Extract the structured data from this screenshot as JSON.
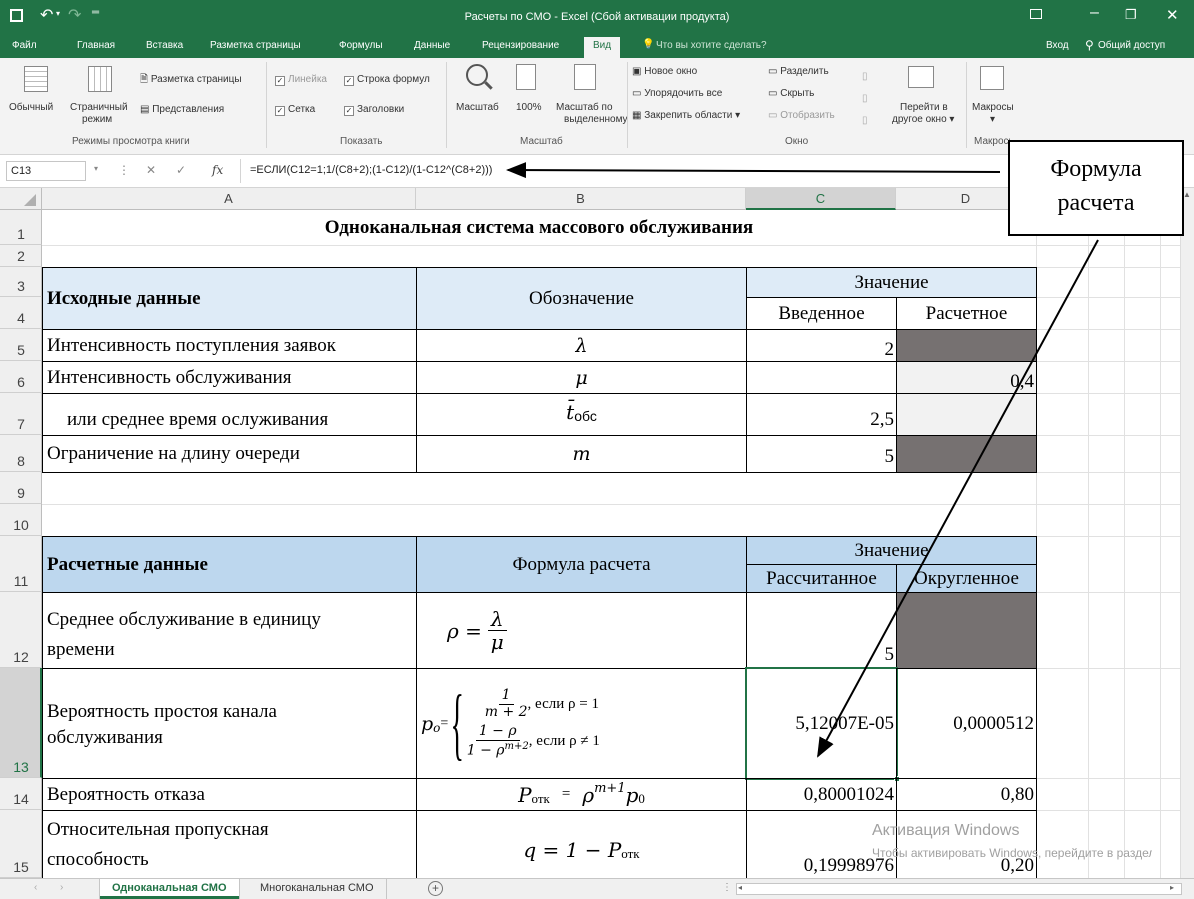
{
  "titlebar": {
    "title": "Расчеты по СМО - Excel (Сбой активации продукта)",
    "undo_icon": "undo-icon",
    "redo_icon": "redo-icon"
  },
  "ribbon_tabs": [
    "Файл",
    "Главная",
    "Вставка",
    "Разметка страницы",
    "Формулы",
    "Данные",
    "Рецензирование",
    "Вид"
  ],
  "tell_me": "Что вы хотите сделать?",
  "account": {
    "signin": "Вход",
    "share": "Общий доступ"
  },
  "ribbon": {
    "views": {
      "normal": "Обычный",
      "page_break_1": "Страничный",
      "page_break_2": "режим",
      "page_layout": "Разметка страницы",
      "custom_views": "Представления",
      "group": "Режимы просмотра книги"
    },
    "show": {
      "ruler": "Линейка",
      "formula_bar": "Строка формул",
      "gridlines": "Сетка",
      "headings": "Заголовки",
      "group": "Показать"
    },
    "zoom": {
      "zoom": "Масштаб",
      "hundred": "100%",
      "zoom_sel_1": "Масштаб по",
      "zoom_sel_2": "выделенному",
      "group": "Масштаб"
    },
    "window": {
      "new_window": "Новое окно",
      "arrange": "Упорядочить все",
      "freeze": "Закрепить области",
      "split": "Разделить",
      "hide": "Скрыть",
      "unhide": "Отобразить",
      "switch_1": "Перейти в",
      "switch_2": "другое окно",
      "group": "Окно"
    },
    "macros": {
      "macros": "Макросы",
      "group": "Макросы"
    }
  },
  "formula_bar": {
    "name_box": "C13",
    "fx": "fx",
    "formula": "=ЕСЛИ(C12=1;1/(C8+2);(1-C12)/(1-C12^(C8+2)))"
  },
  "columns": [
    "A",
    "B",
    "C",
    "D"
  ],
  "rows": [
    "1",
    "2",
    "3",
    "4",
    "5",
    "6",
    "7",
    "8",
    "9",
    "10",
    "11",
    "12",
    "13",
    "14",
    "15"
  ],
  "cells": {
    "title": "Одноканальная система массового обслуживания",
    "src_header": "Исходные данные",
    "src_notation": "Обозначение",
    "value": "Значение",
    "entered": "Введенное",
    "calculated": "Расчетное",
    "r5a": "Интенсивность поступления заявок",
    "r5b": "λ",
    "r5c": "2",
    "r6a": "Интенсивность обслуживания",
    "r6b": "μ",
    "r6d": "0,4",
    "r7a": "или среднее время ослуживания",
    "r7b": "t̄",
    "r7b_sub": "обс",
    "r7c": "2,5",
    "r8a": "Ограничение на длину очереди",
    "r8b": "m",
    "r8c": "5",
    "calc_header": "Расчетные данные",
    "calc_formula": "Формула расчета",
    "value2": "Значение",
    "computed": "Рассчитанное",
    "rounded": "Округленное",
    "r12a_1": "Среднее обслуживание в единицу",
    "r12a_2": "времени",
    "r12b_lhs": "ρ =",
    "r12b_num": "λ",
    "r12b_den": "μ",
    "r12c": "5",
    "r13a_1": "Вероятность простоя канала",
    "r13a_2": "обслуживания",
    "r13b_lhs": "p",
    "r13b_sub": "o",
    "r13b_eq": "=",
    "r13b_f1_num": "1",
    "r13b_f1_den": "m + 2",
    "r13b_f1_cond": ", если ρ = 1",
    "r13b_f2_num": "1 − ρ",
    "r13b_f2_den": "1 − ρ",
    "r13b_f2_den_sup": "m+2",
    "r13b_f2_cond": ", если ρ ≠ 1",
    "r13c": "5,12007E-05",
    "r13d": "0,0000512",
    "r14a": "Вероятность отказа",
    "r14b_lhs": "P",
    "r14b_lhs_sub": "отк",
    "r14b_eq": "=",
    "r14b_rhs": "ρ",
    "r14b_sup": "m+1",
    "r14b_p": "p",
    "r14b_p_sub": "0",
    "r14c": "0,80001024",
    "r14d": "0,80",
    "r15a_1": "Относительная пропускная",
    "r15a_2": "способность",
    "r15b_lhs": "q = 1 − P",
    "r15b_sub": "отк",
    "r15c": "0,19998976",
    "r15d": "0,20"
  },
  "callout": {
    "line1": "Формула",
    "line2": "расчета"
  },
  "watermark": {
    "line1": "Активация Windows",
    "line2": "Чтобы активировать Windows, перейдите в раздел \"Параметры\"."
  },
  "sheets": [
    "Одноканальная СМО",
    "Многоканальная СМО"
  ],
  "colors": {
    "excel_green": "#217346",
    "header_light": "#deebf7",
    "header_blue": "#bdd7ee",
    "dark_gray": "#767171"
  }
}
